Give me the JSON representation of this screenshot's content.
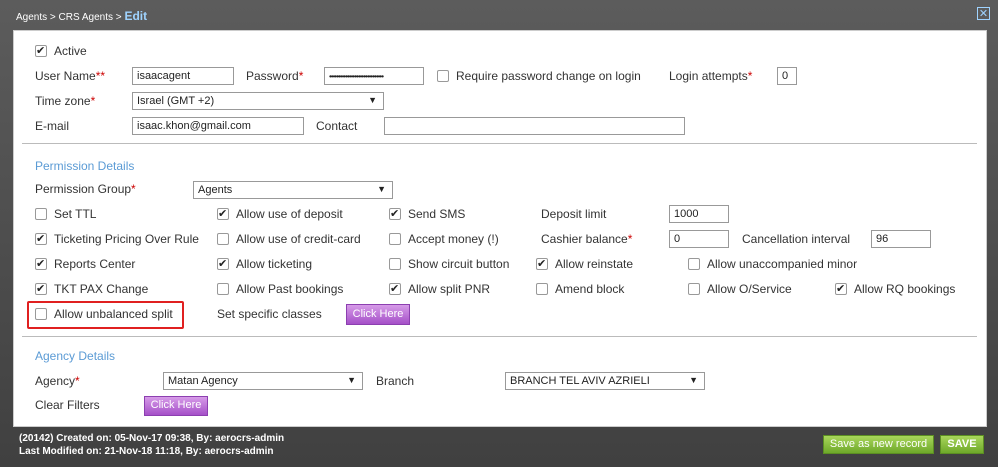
{
  "breadcrumb": {
    "part1": "Agents",
    "sep1": " > ",
    "part2": "CRS Agents",
    "sep2": " > ",
    "current": "Edit"
  },
  "close_glyph": "✕",
  "general": {
    "active": {
      "label": "Active",
      "checked": true
    },
    "username": {
      "label": "User Name",
      "req": "**",
      "value": "isaacagent"
    },
    "password": {
      "label": "Password",
      "req": "*",
      "value": "••••••••••••••••••••••••••••••"
    },
    "require_pw_change": {
      "label": "Require password change on login",
      "checked": false
    },
    "login_attempts": {
      "label": "Login attempts",
      "req": "*",
      "value": "0"
    },
    "timezone": {
      "label": "Time zone",
      "req": "*",
      "value": "Israel (GMT +2)"
    },
    "email": {
      "label": "E-mail",
      "value": "isaac.khon@gmail.com"
    },
    "contact": {
      "label": "Contact",
      "value": ""
    }
  },
  "permission": {
    "title": "Permission Details",
    "group": {
      "label": "Permission Group",
      "req": "*",
      "value": "Agents"
    },
    "checks": {
      "set_ttl": {
        "label": "Set TTL",
        "checked": false
      },
      "allow_deposit": {
        "label": "Allow use of deposit",
        "checked": true
      },
      "send_sms": {
        "label": "Send SMS",
        "checked": true
      },
      "ticketing_pricing": {
        "label": "Ticketing Pricing Over Rule",
        "checked": true
      },
      "allow_credit": {
        "label": "Allow use of credit-card",
        "checked": false
      },
      "accept_money": {
        "label": "Accept money (!)",
        "checked": false
      },
      "reports_center": {
        "label": "Reports Center",
        "checked": true
      },
      "allow_ticketing": {
        "label": "Allow ticketing",
        "checked": true
      },
      "show_circuit": {
        "label": "Show circuit button",
        "checked": false
      },
      "allow_reinstate": {
        "label": "Allow reinstate",
        "checked": true
      },
      "allow_unaccompanied": {
        "label": "Allow unaccompanied minor",
        "checked": false
      },
      "tkt_pax_change": {
        "label": "TKT PAX Change",
        "checked": true
      },
      "allow_past": {
        "label": "Allow Past bookings",
        "checked": false
      },
      "allow_split_pnr": {
        "label": "Allow split PNR",
        "checked": true
      },
      "amend_block": {
        "label": "Amend block",
        "checked": false
      },
      "allow_oservice": {
        "label": "Allow O/Service",
        "checked": false
      },
      "allow_rq": {
        "label": "Allow RQ bookings",
        "checked": true
      },
      "allow_unbalanced": {
        "label": "Allow unbalanced split",
        "checked": false
      }
    },
    "deposit_limit": {
      "label": "Deposit limit",
      "value": "1000"
    },
    "cashier_balance": {
      "label": "Cashier balance",
      "req": "*",
      "value": "0"
    },
    "cancellation_interval": {
      "label": "Cancellation interval",
      "value": "96"
    },
    "set_classes": {
      "label": "Set specific classes",
      "button": "Click Here"
    }
  },
  "agency": {
    "title": "Agency Details",
    "agency": {
      "label": "Agency",
      "req": "*",
      "value": "Matan Agency"
    },
    "branch": {
      "label": "Branch",
      "value": "BRANCH TEL AVIV AZRIELI"
    },
    "clear_filters": {
      "label": "Clear Filters",
      "button": "Click Here"
    }
  },
  "footer": {
    "created": "(20142) Created on: 05-Nov-17 09:38, By: aerocrs-admin",
    "modified": "Last Modified on: 21-Nov-18 11:18, By: aerocrs-admin",
    "save_new": "Save as new record",
    "save": "SAVE"
  },
  "colors": {
    "accent": "#5b9bd5",
    "green": "#7cb82f",
    "purple": "#b062d4",
    "highlight": "#e02020"
  }
}
